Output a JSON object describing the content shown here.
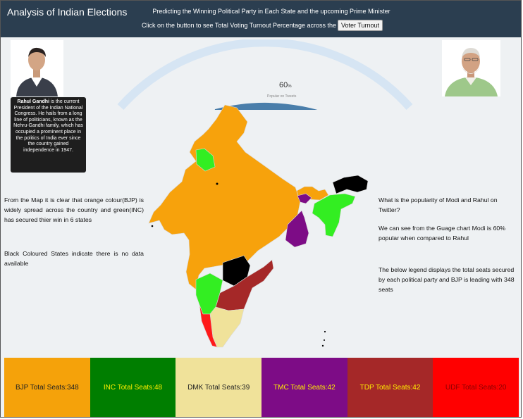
{
  "header": {
    "title": "Analysis of Indian Elections",
    "subtitle": "Predicting the Winning Political Party in Each State and the upcoming Prime Minister",
    "instruction": "Click on the button to see Total Voting Turnout Percentage across the States",
    "button_label": "Voter Turnout"
  },
  "rahul": {
    "name": "Rahul Gandhi",
    "bio": " is the current President of the Indian National Congress. He hails from a long line of politicians, known as the Nehru-Gandhi family, which has occupied a prominent place in the politics of India ever since the country gained independence in 1947."
  },
  "gauge": {
    "value": 60,
    "value_text": "60",
    "unit": "%",
    "label": "Popular on Tweets",
    "colors": {
      "fill": "#4a7eaa",
      "track": "#d6e5f3"
    }
  },
  "left_notes": {
    "map_note": "From the Map it is clear that orange colour(BJP) is widely spread across the country and green(INC) has secured thier win in 6 states",
    "black_note": "Black Coloured States indicate there is no data available"
  },
  "right_notes": {
    "question": "What is the popularity of Modi and Rahul on Twitter?",
    "answer": "We can see from the Guage chart Modi is 60% popular when compared to Rahul",
    "legend_note": "The below legend displays the total seats secured by each political party and BJP is leading with 348 seats"
  },
  "legend": [
    {
      "label": "BJP Total Seats:348",
      "bg": "#f5a20a",
      "fg": "#222222"
    },
    {
      "label": "INC Total Seats:48",
      "bg": "#007e00",
      "fg": "#ffee00"
    },
    {
      "label": "DMK Total Seats:39",
      "bg": "#f0e29a",
      "fg": "#222222"
    },
    {
      "label": "TMC Total Seats:42",
      "bg": "#7d0c86",
      "fg": "#ffee00"
    },
    {
      "label": "TDP Total Seats:42",
      "bg": "#a52828",
      "fg": "#ffee00"
    },
    {
      "label": "UDF Total Seats:20",
      "bg": "#ff0000",
      "fg": "#8a0000"
    }
  ],
  "map_colors": {
    "bjp": "#f7a20c",
    "inc": "#33ee22",
    "dmk": "#f0e29a",
    "tmc": "#7d0c86",
    "tdp": "#a52828",
    "udf": "#ff1a1a",
    "no_data": "#000000"
  }
}
